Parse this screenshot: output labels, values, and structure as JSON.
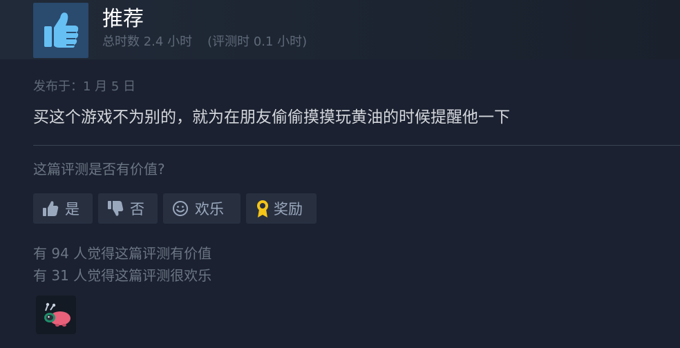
{
  "review": {
    "verdict": "推荐",
    "hours_total": "总时数 2.4 小时",
    "hours_at_review": "(评测时 0.1 小时)",
    "posted": "发布于：1 月 5 日",
    "text": "买这个游戏不为别的，就为在朋友偷偷摸摸玩黄油的时候提醒他一下"
  },
  "feedback": {
    "question": "这篇评测是否有价值?",
    "buttons": {
      "yes": "是",
      "no": "否",
      "funny": "欢乐",
      "award": "奖励"
    },
    "helpful_stat": "有 94 人觉得这篇评测有价值",
    "funny_stat": "有 31 人觉得这篇评测很欢乐"
  },
  "icons": {
    "verdict": "thumbs-up-icon",
    "yes": "thumbs-up-icon",
    "no": "thumbs-down-icon",
    "funny": "smiley-icon",
    "award": "award-ribbon-icon",
    "received_award": "award-badge-icon"
  },
  "colors": {
    "background": "#1b2130",
    "thumb_box": "#2a4a6e",
    "thumb_icon": "#66c0f4",
    "award_gold": "#f5c518",
    "button_bg": "#283040"
  }
}
